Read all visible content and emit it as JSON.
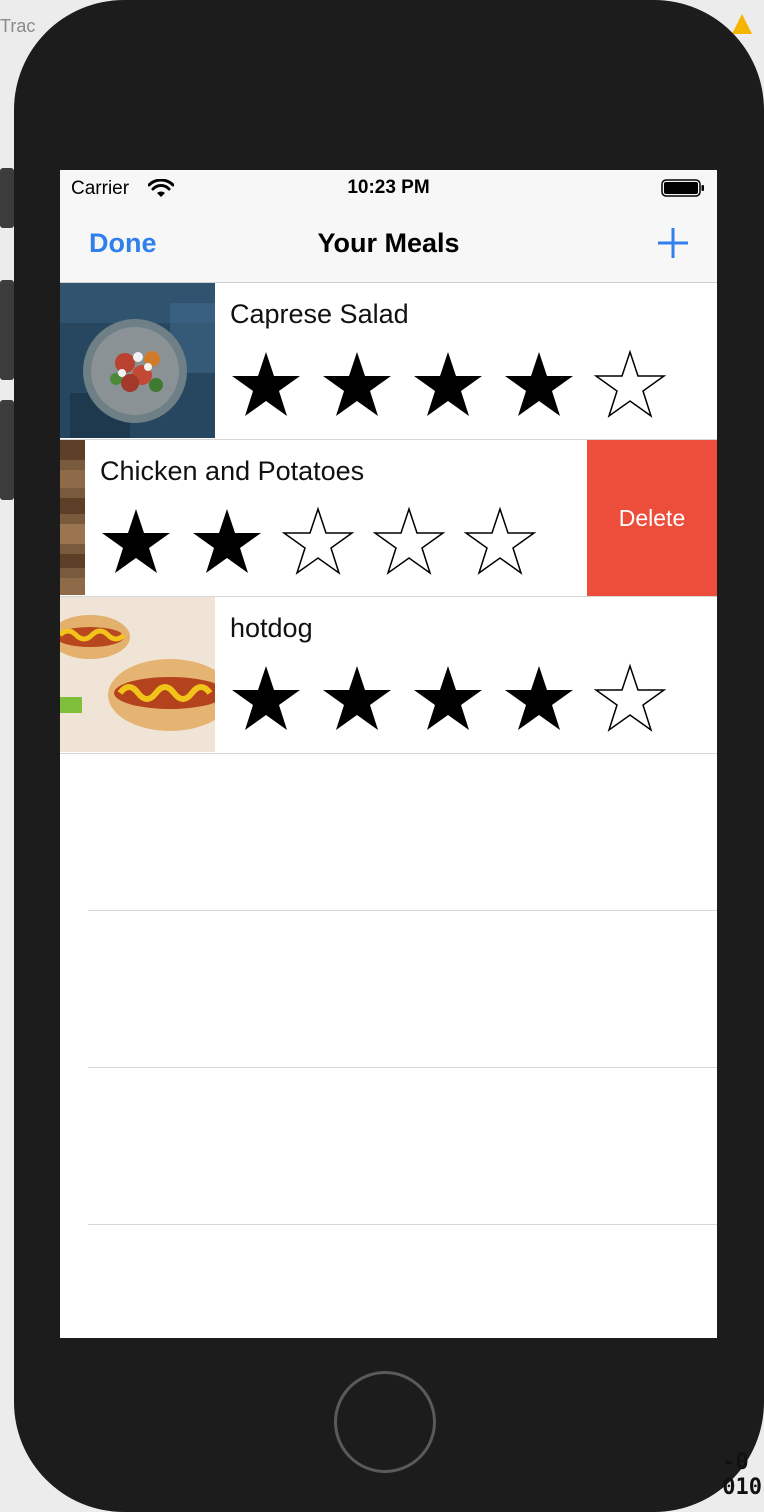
{
  "background": {
    "top_left_text": "Trac",
    "bottom_right_code": "-0\n010"
  },
  "status_bar": {
    "carrier": "Carrier",
    "time": "10:23 PM"
  },
  "nav_bar": {
    "left_button": "Done",
    "title": "Your Meals",
    "right_button_icon": "plus-icon"
  },
  "meals": [
    {
      "name": "Caprese Salad",
      "rating": 4,
      "max_rating": 5,
      "photo": "caprese-salad-photo"
    },
    {
      "name": "Chicken and Potatoes",
      "rating": 2,
      "max_rating": 5,
      "photo": "chicken-potatoes-photo",
      "swiped": true,
      "swipe_action": "Delete"
    },
    {
      "name": "hotdog",
      "rating": 4,
      "max_rating": 5,
      "photo": "hotdog-photo"
    }
  ],
  "colors": {
    "tint": "#2f80ed",
    "delete": "#ed4e3c",
    "bar_background": "#f7f7f7"
  }
}
